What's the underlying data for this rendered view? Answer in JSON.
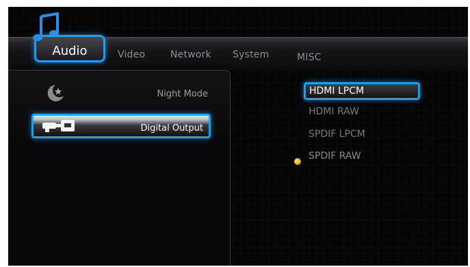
{
  "tabs": [
    {
      "label": "Audio",
      "active": true
    },
    {
      "label": "Video",
      "active": false
    },
    {
      "label": "Network",
      "active": false
    },
    {
      "label": "System",
      "active": false
    },
    {
      "label": "MISC",
      "active": false
    }
  ],
  "left_menu": [
    {
      "label": "Night Mode",
      "icon": "moon-star-icon",
      "selected": false
    },
    {
      "label": "Digital Output",
      "icon": "digital-output-icon",
      "selected": true
    }
  ],
  "options": [
    {
      "label": "HDMI LPCM",
      "focused": true,
      "chosen": false
    },
    {
      "label": "HDMI RAW",
      "focused": false,
      "chosen": false
    },
    {
      "label": "SPDIF LPCM",
      "focused": false,
      "chosen": false
    },
    {
      "label": "SPDIF RAW",
      "focused": false,
      "chosen": true
    }
  ],
  "colors": {
    "focus_border": "#1aa0f0",
    "chosen_dot": "#f0a010",
    "background": "#050506"
  }
}
